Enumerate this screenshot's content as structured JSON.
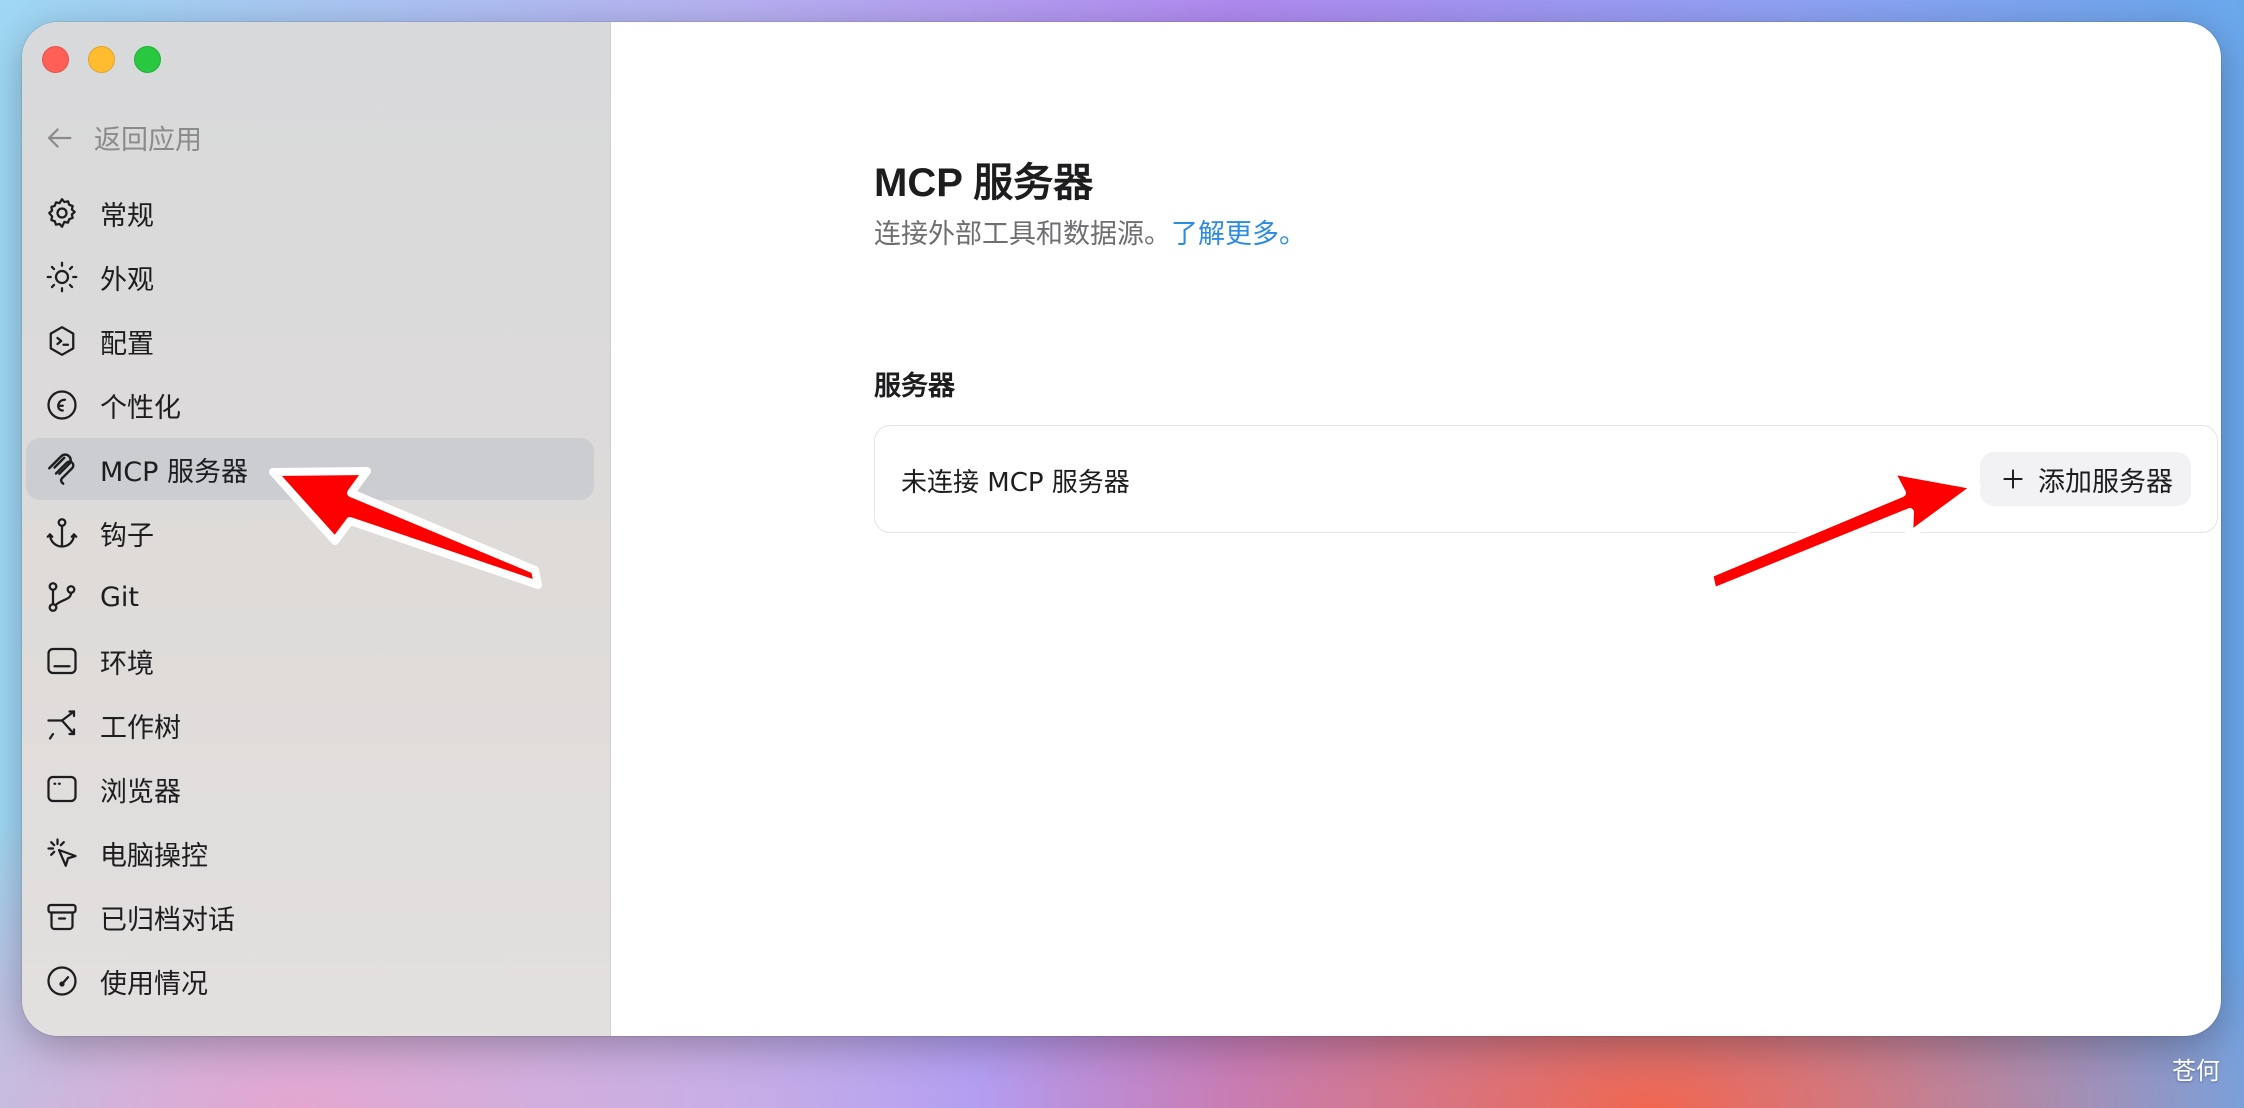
{
  "sidebar": {
    "back_label": "返回应用",
    "items": [
      {
        "label": "常规",
        "icon": "gear-icon"
      },
      {
        "label": "外观",
        "icon": "sun-icon"
      },
      {
        "label": "配置",
        "icon": "shield-terminal-icon"
      },
      {
        "label": "个性化",
        "icon": "smile-icon"
      },
      {
        "label": "MCP 服务器",
        "icon": "mcp-icon",
        "active": true
      },
      {
        "label": "钩子",
        "icon": "anchor-icon"
      },
      {
        "label": "Git",
        "icon": "git-branch-icon"
      },
      {
        "label": "环境",
        "icon": "environment-icon"
      },
      {
        "label": "工作树",
        "icon": "worktree-icon"
      },
      {
        "label": "浏览器",
        "icon": "browser-icon"
      },
      {
        "label": "电脑操控",
        "icon": "cursor-click-icon"
      },
      {
        "label": "已归档对话",
        "icon": "archive-icon"
      },
      {
        "label": "使用情况",
        "icon": "gauge-icon"
      }
    ]
  },
  "main": {
    "title": "MCP 服务器",
    "subtitle": "连接外部工具和数据源。",
    "learn_more": "了解更多。",
    "section_label": "服务器",
    "empty_text": "未连接 MCP 服务器",
    "add_button": "添加服务器"
  },
  "watermark": "苍何",
  "colors": {
    "accent_link": "#2b8ce6",
    "annotation_arrow": "#ff0000",
    "traffic_red": "#ff5f57",
    "traffic_yellow": "#febc2e",
    "traffic_green": "#28c840"
  }
}
